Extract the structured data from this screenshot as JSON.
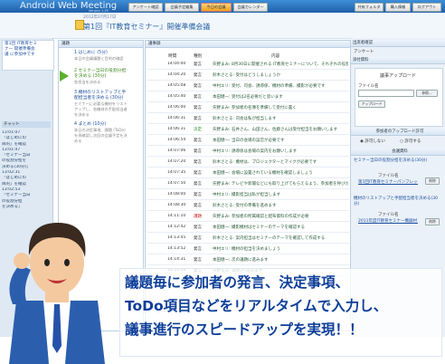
{
  "app": {
    "title": "Android Web Meeting",
    "version": "Version 1.29"
  },
  "top_buttons": [
    {
      "label": "アンケート確認"
    },
    {
      "label": "会議予定編集"
    },
    {
      "label": "今日の会議"
    },
    {
      "label": "会議カレンダー"
    },
    {
      "label": "共有フォルダ"
    },
    {
      "label": "購入情報"
    },
    {
      "label": "ログアウト"
    }
  ],
  "meeting": {
    "date": "2012年07月17日",
    "title": "第1回『IT教育セミナー』開催準備会議"
  },
  "left": {
    "box_lines": [
      "第1回 IT教育セミ",
      "ナー 開催準備会",
      "議 に参加中です"
    ],
    "chat_label": "チャット",
    "chat": [
      "13:01:07",
      "「はじめにの",
      "目的」を確認",
      "13:01:47",
      "「セミナー当日",
      "の役割分担を",
      "決める(30分)」",
      "13:02:31",
      "「はじめにの",
      "目的」を確認",
      "13:02:53",
      "「セミナー当日",
      "の役割分担",
      "を決める」"
    ]
  },
  "agenda": {
    "header": "議題",
    "items": [
      {
        "title": "1 はじめに (5分)",
        "desc": "本日の会議議題と目的の確認"
      },
      {
        "title": "2 セミナー当日の役割分担を決める (30分)",
        "desc": "各担当を決める"
      },
      {
        "title": "3 機材のリストアップと手配担当者を決める (30分)",
        "desc": "セミナーに必要な機材をリストアップし、各機材の手配担当者を決める"
      },
      {
        "title": "4 まとめ (10分)",
        "desc": "本日の決定事項、課題 (ToDo) を再確認し次回の会議予定を決める"
      }
    ]
  },
  "minutes": {
    "header": "議事録",
    "columns": [
      "時間",
      "種別",
      "内容"
    ],
    "rows": [
      {
        "time": "14:04:00",
        "type": "発言",
        "kind": "normal",
        "content": "矢野まみ: 8月30日に開催される IT教育セミナーについて、それぞれの役割分担を決めましょう"
      },
      {
        "time": "14:04:20",
        "type": "発言",
        "kind": "normal",
        "content": "鈴木さとる: 受付はどうしましょうか"
      },
      {
        "time": "14:05:08",
        "type": "発言",
        "kind": "normal",
        "content": "中村エリ: 受付、司会、誘導係、機材の準備、撮影が必要です"
      },
      {
        "time": "14:05:40",
        "type": "発言",
        "kind": "normal",
        "content": "本田健一: 受付は2名必要だと思います"
      },
      {
        "time": "14:06:00",
        "type": "発言",
        "kind": "normal",
        "content": "矢野まみ: 参加者の名簿を準備して受付に置く"
      },
      {
        "time": "14:06:31",
        "type": "発言",
        "kind": "normal",
        "content": "鈴木さとる: 司会は私が担当します"
      },
      {
        "time": "14:06:31",
        "type": "決定",
        "kind": "ok",
        "content": "矢野まみ: 石井さん、山田さん、佐藤さんは受付担当をお願いします"
      },
      {
        "time": "14:06:54",
        "type": "発言",
        "kind": "normal",
        "content": "本田健一: 当日の会場の設営が必要です"
      },
      {
        "time": "14:07:06",
        "type": "発言",
        "kind": "normal",
        "content": "中村エリ: 誘導係は会場の案内をお願いします"
      },
      {
        "time": "14:07:20",
        "type": "発言",
        "kind": "normal",
        "content": "鈴木さとる: 機材は、プロジェクターとマイクが必要です"
      },
      {
        "time": "14:07:35",
        "type": "発言",
        "kind": "normal",
        "content": "本田健一: 会場に設置されている機材を確認しましょう"
      },
      {
        "time": "14:07:50",
        "type": "発言",
        "kind": "normal",
        "content": "矢野まみ: テレビや新聞などにも取り上げてもらえるよう、参加者を呼びかけます"
      },
      {
        "time": "14:08:00",
        "type": "発言",
        "kind": "normal",
        "content": "中村エリ: 撮影担当は私が担当します"
      },
      {
        "time": "14:08:30",
        "type": "発言",
        "kind": "normal",
        "content": "鈴木さとる: 受付の準備を進めます"
      },
      {
        "time": "14:11:10",
        "type": "課題",
        "kind": "ng",
        "content": "矢野まみ: 参加者の所属確認と配布資料の作成が必要"
      },
      {
        "time": "14:12:42",
        "type": "発言",
        "kind": "normal",
        "content": "本田健一: 撮影機材はセミナーのテーマを確認する"
      },
      {
        "time": "14:13:45",
        "type": "発言",
        "kind": "normal",
        "content": "鈴木さとる: 案内担当はセミナーのテーマを確認して作成する"
      },
      {
        "time": "14:13:52",
        "type": "発言",
        "kind": "normal",
        "content": "中村エリ: 機材の担当を決めましょう"
      },
      {
        "time": "14:14:31",
        "type": "発言",
        "kind": "normal",
        "content": "本田健一: 次の議題に進みます"
      },
      {
        "time": "14:14:48",
        "type": "発言",
        "kind": "normal",
        "content": "矢野まみ: 議題3へ進みます"
      }
    ]
  },
  "right": {
    "attendees_header": "出席者確認",
    "survey_label": "アンケート",
    "attachments_header": "添付資料",
    "upload_header": "議事アップロード",
    "file_label": "ファイル名",
    "browse_label": "参照...",
    "upload_label": "アップロード",
    "permission_header": "参加者のアップロード許可",
    "permit_options": [
      "許可しない",
      "許可する"
    ],
    "documents_header": "会議資料",
    "doc_section1": "セミナー当日の役割分担を決める(30分)",
    "doc1_name": "第1回IT教育セミナーパンフレット.pdf",
    "doc_section2": "機材のリストアップと手配担当者を決める(30分)",
    "doc2_name": "2011年度IT教育セミナー機器材リスト.pdf",
    "delete_label": "削除"
  },
  "banner": {
    "lines": [
      "議題毎に参加者の発言、決定事項、",
      "ToDo項目などをリアルタイムで入力し、",
      "議事進行のスピードアップを実現！！"
    ]
  }
}
